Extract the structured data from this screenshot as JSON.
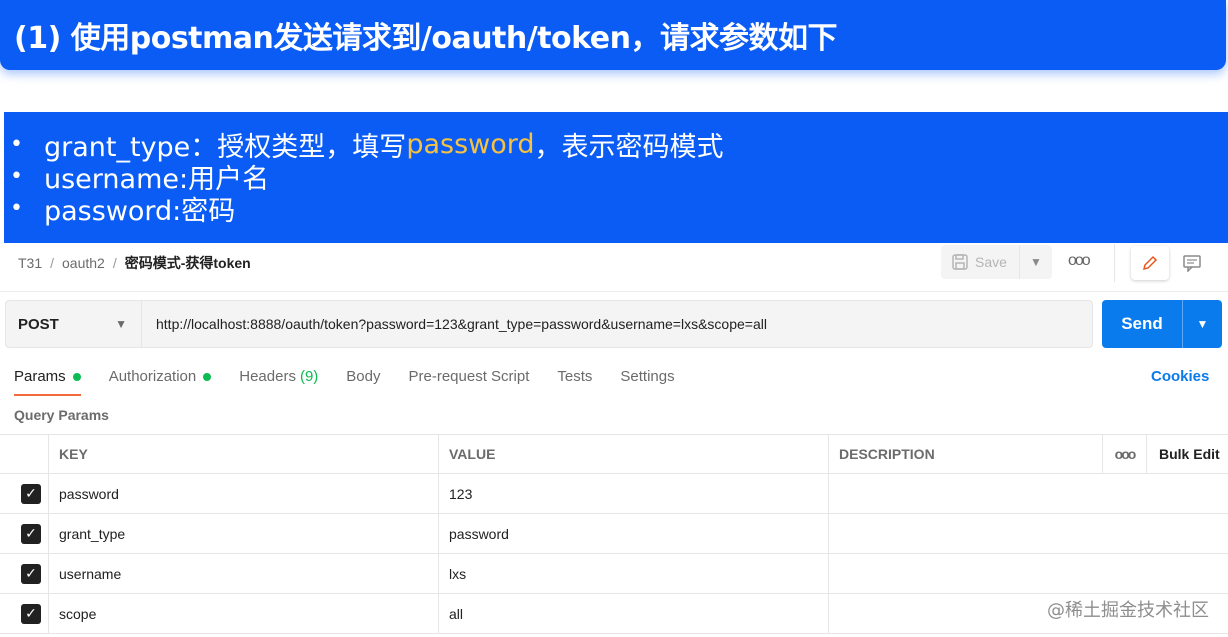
{
  "slide": {
    "title": "(1) 使用postman发送请求到/oauth/token，请求参数如下",
    "bullets": [
      {
        "prefix": "grant_type：授权类型，填写",
        "highlight": "password",
        "suffix": "，表示密码模式"
      },
      {
        "prefix": "username:用户名",
        "highlight": "",
        "suffix": ""
      },
      {
        "prefix": "password:密码",
        "highlight": "",
        "suffix": ""
      }
    ],
    "bullet_glyph": "•"
  },
  "breadcrumb": {
    "items": [
      "T31",
      "oauth2"
    ],
    "current": "密码模式-获得token",
    "separator": "/"
  },
  "toolbar": {
    "save_label": "Save",
    "more_glyph": "ooo"
  },
  "request": {
    "method": "POST",
    "url": "http://localhost:8888/oauth/token?password=123&grant_type=password&username=lxs&scope=all",
    "send_label": "Send"
  },
  "tabs": [
    {
      "label": "Params",
      "dot": true,
      "count": ""
    },
    {
      "label": "Authorization",
      "dot": true,
      "count": ""
    },
    {
      "label": "Headers",
      "dot": false,
      "count": "(9)"
    },
    {
      "label": "Body",
      "dot": false,
      "count": ""
    },
    {
      "label": "Pre-request Script",
      "dot": false,
      "count": ""
    },
    {
      "label": "Tests",
      "dot": false,
      "count": ""
    },
    {
      "label": "Settings",
      "dot": false,
      "count": ""
    }
  ],
  "cookies_label": "Cookies",
  "query_params": {
    "title": "Query Params",
    "columns": {
      "key": "KEY",
      "value": "VALUE",
      "description": "DESCRIPTION",
      "more": "ooo",
      "bulk_edit": "Bulk Edit"
    },
    "rows": [
      {
        "key": "password",
        "value": "123",
        "description": "",
        "checked": true
      },
      {
        "key": "grant_type",
        "value": "password",
        "description": "",
        "checked": true
      },
      {
        "key": "username",
        "value": "lxs",
        "description": "",
        "checked": true
      },
      {
        "key": "scope",
        "value": "all",
        "description": "",
        "checked": true
      }
    ]
  },
  "watermark": "@稀土掘金技术社区",
  "colors": {
    "slide_blue": "#0a5cf5",
    "highlight_yellow": "#f5c242",
    "send_blue": "#097bed",
    "active_tab_orange": "#f26b3a",
    "status_green": "#0cbb52"
  },
  "icons": {
    "save": "save-disk-icon",
    "edit": "pencil-icon",
    "comment": "comment-icon",
    "caret": "chevron-down-icon",
    "checkbox": "checkbox-checked-icon"
  }
}
